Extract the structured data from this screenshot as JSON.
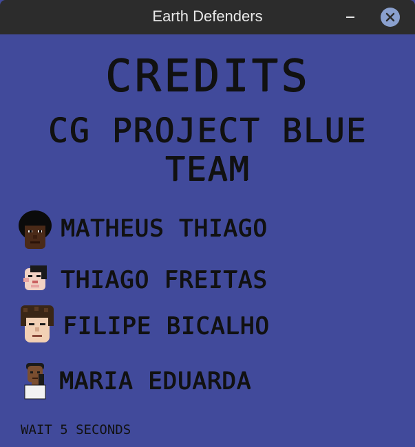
{
  "window": {
    "title": "Earth Defenders"
  },
  "credits": {
    "heading": "CREDITS",
    "project_line1": "CG PROJECT BLUE",
    "project_line2": "TEAM",
    "members": [
      {
        "name": "MATHEUS THIAGO",
        "icon": "avatar-afro-icon"
      },
      {
        "name": "THIAGO FREITAS",
        "icon": "avatar-pale-icon"
      },
      {
        "name": "FILIPE BICALHO",
        "icon": "avatar-curly-icon"
      },
      {
        "name": "MARIA EDUARDA",
        "icon": "avatar-portrait-icon"
      }
    ],
    "footer": "WAIT 5 SECONDS"
  },
  "colors": {
    "background": "#414a9b",
    "text": "#111111",
    "titlebar": "#2c2c2c"
  }
}
